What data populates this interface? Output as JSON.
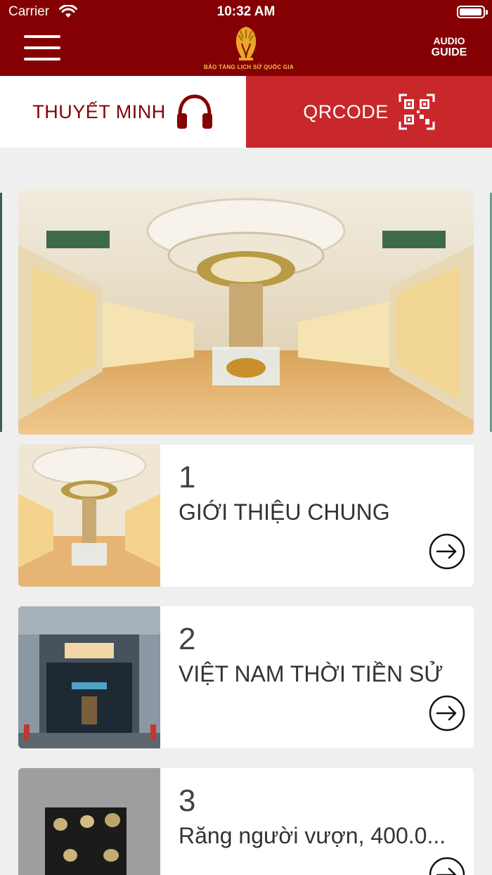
{
  "status_bar": {
    "carrier": "Carrier",
    "time": "10:32 AM"
  },
  "header": {
    "logo_text": "BẢO TÀNG LỊCH SỬ QUỐC GIA",
    "audio_guide_top": "AUDIO",
    "audio_guide_bottom": "GUIDE"
  },
  "tabs": [
    {
      "label": "THUYẾT MINH",
      "icon": "headphones-icon",
      "active": true
    },
    {
      "label": "QRCODE",
      "icon": "qr-code-icon",
      "active": false
    }
  ],
  "items": [
    {
      "number": "1",
      "title": "GIỚI THIỆU CHUNG"
    },
    {
      "number": "2",
      "title": "VIỆT NAM THỜI TIỀN SỬ"
    },
    {
      "number": "3",
      "title": "Răng người vượn, 400.0..."
    }
  ],
  "colors": {
    "brand_dark_red": "#850003",
    "active_red": "#c8282c",
    "background": "#efefef"
  }
}
